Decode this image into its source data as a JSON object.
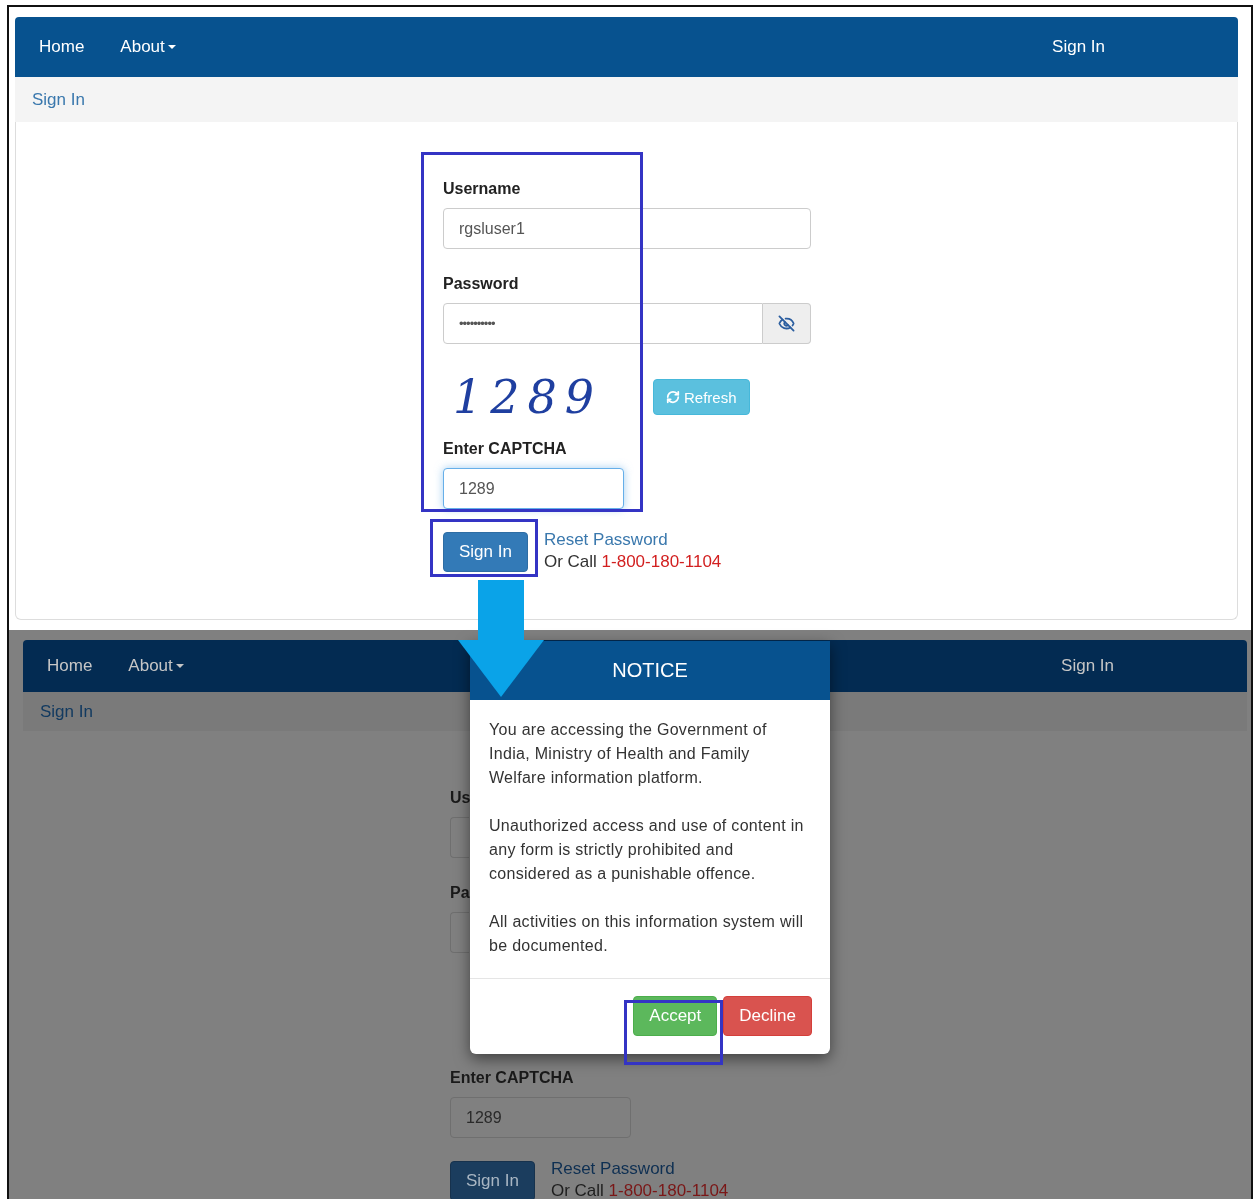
{
  "login_screen": {
    "navbar": {
      "items": [
        {
          "label": "Home",
          "dropdown": false
        },
        {
          "label": "About",
          "dropdown": true
        }
      ],
      "right_link": "Sign In"
    },
    "breadcrumb": "Sign In",
    "form": {
      "username_label": "Username",
      "username_value": "rgsluser1",
      "password_label": "Password",
      "password_value": "••••••••••",
      "captcha": "1289",
      "refresh_button": "Refresh",
      "captcha_label": "Enter CAPTCHA",
      "captcha_value": "1289",
      "captcha_focused": true,
      "sign_in_button": "Sign In",
      "reset_link": "Reset Password",
      "call_prefix": "Or Call",
      "phone": "1-800-180-1104"
    }
  },
  "notice_screen": {
    "navbar": {
      "items": [
        {
          "label": "Home",
          "dropdown": false
        },
        {
          "label": "About",
          "dropdown": true
        }
      ],
      "right_link": "Sign In"
    },
    "breadcrumb": "Sign In",
    "form": {
      "username_label": "Us",
      "password_label": "Pa",
      "captcha_label": "Enter CAPTCHA",
      "captcha_value": "1289",
      "sign_in_button": "Sign In",
      "reset_link": "Reset Password",
      "call_prefix": "Or Call",
      "phone": "1-800-180-1104"
    },
    "modal": {
      "title": "NOTICE",
      "paragraphs": [
        "You are accessing the Government of India, Ministry of Health and Family Welfare information platform.",
        "Unauthorized access and use of content in any form is strictly prohibited and considered as a punishable offence.",
        "All activities on this information system will be documented."
      ],
      "buttons": [
        {
          "label": "Accept",
          "kind": "accept"
        },
        {
          "label": "Decline",
          "kind": "decline"
        }
      ]
    }
  }
}
